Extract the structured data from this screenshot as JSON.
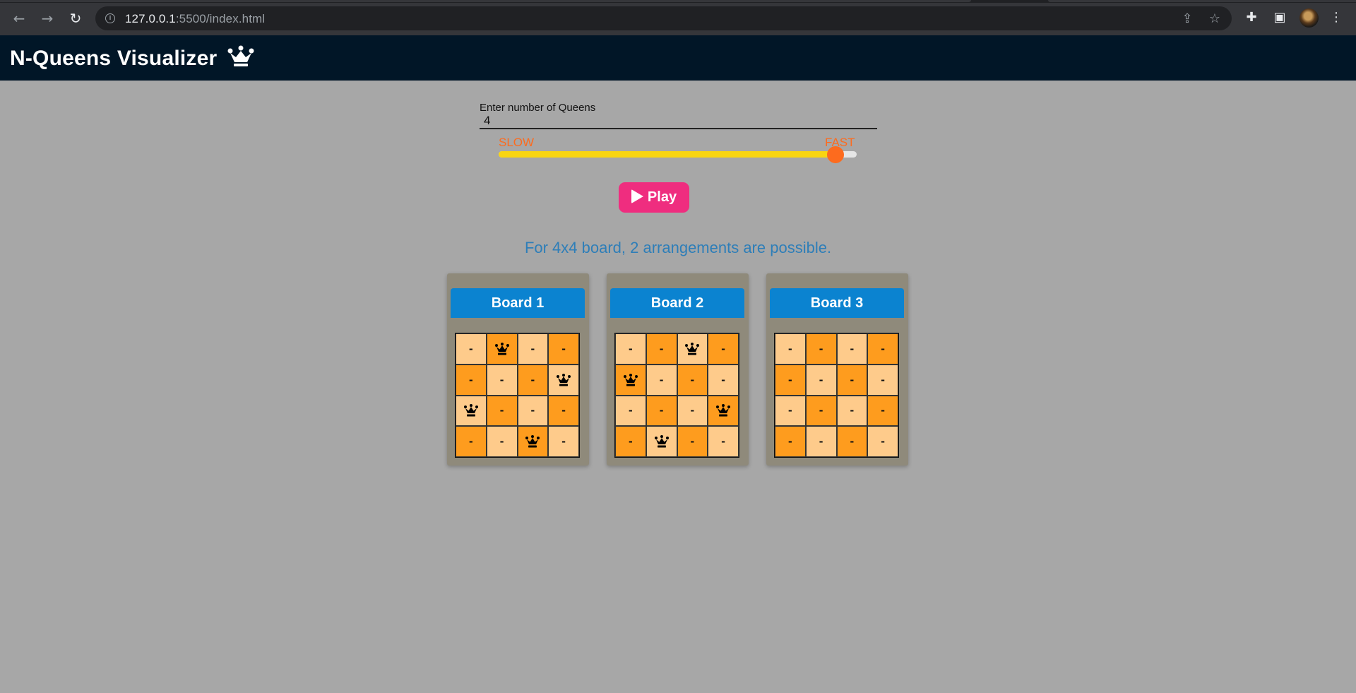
{
  "browser": {
    "url_host": "127.0.0.1",
    "url_rest": ":5500/index.html"
  },
  "app": {
    "title": "N-Queens Visualizer"
  },
  "controls": {
    "queens_label": "Enter number of Queens",
    "queens_value": "4",
    "speed_slow": "SLOW",
    "speed_fast": "FAST",
    "speed_level": 0.94,
    "play_label": "Play"
  },
  "result_text": "For 4x4 board, 2 arrangements are possible.",
  "empty_symbol": "-",
  "boards": [
    {
      "title": "Board 1",
      "queens": [
        [
          0,
          1
        ],
        [
          1,
          3
        ],
        [
          2,
          0
        ],
        [
          3,
          2
        ]
      ]
    },
    {
      "title": "Board 2",
      "queens": [
        [
          0,
          2
        ],
        [
          1,
          0
        ],
        [
          2,
          3
        ],
        [
          3,
          1
        ]
      ]
    },
    {
      "title": "Board 3",
      "queens": []
    }
  ],
  "colors": {
    "light_square": "#fecb8b",
    "dark_square": "#fe9c1e",
    "board_header": "#0b83d0",
    "play_button": "#ef2d7f",
    "slider_fill": "#f9d512",
    "slider_thumb": "#fd6b1e"
  },
  "icons": {
    "queen": "crown-icon"
  }
}
